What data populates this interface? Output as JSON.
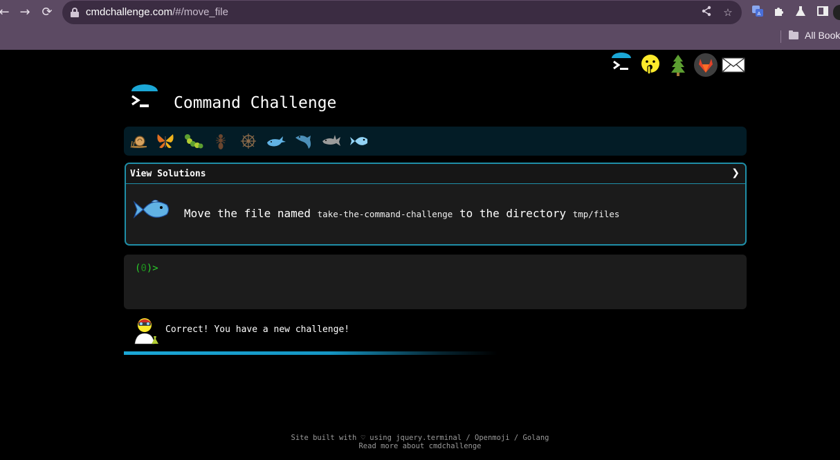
{
  "browser": {
    "url_host": "cmdchallenge.com",
    "url_path": "/#/move_file",
    "bookmarks_label": "All Book",
    "icons": [
      "back-icon",
      "forward-icon",
      "reload-icon",
      "lock-icon",
      "share-icon",
      "star-icon",
      "translate-icon",
      "extensions-icon",
      "labs-icon",
      "sidepanel-icon"
    ]
  },
  "header": {
    "title": "Command Challenge",
    "top_icons": [
      "terminal-logo-icon",
      "shushing-face-icon",
      "tree-icon",
      "gitlab-icon",
      "envelope-icon"
    ]
  },
  "levels": {
    "icons": [
      "snail-icon",
      "butterfly-icon",
      "caterpillar-icon",
      "ant-icon",
      "ship-wheel-icon",
      "whale-icon",
      "dolphin-icon",
      "shark-icon",
      "fish-icon"
    ],
    "current": "fish-icon"
  },
  "challenge": {
    "view_solutions": "View Solutions",
    "chevron": "❯",
    "text_before": "Move the file named ",
    "file_name": "take-the-command-challenge",
    "text_middle": " to the directory ",
    "directory": "tmp/files"
  },
  "terminal": {
    "prompt_open": "(",
    "prompt_number": "0",
    "prompt_close": ")>"
  },
  "status": {
    "message": "Correct! You have a new challenge!",
    "progress_fraction": 0.6
  },
  "footer": {
    "line1": "Site built with ♡ using jquery.terminal / Openmoji / Golang",
    "line2": "Read more about cmdchallenge"
  },
  "colors": {
    "chrome": "#5c4a63",
    "omnibox": "#3b2c42",
    "accent": "#1f8fa8",
    "level_bar": "#031c26",
    "prompt": "#2bd02b"
  }
}
